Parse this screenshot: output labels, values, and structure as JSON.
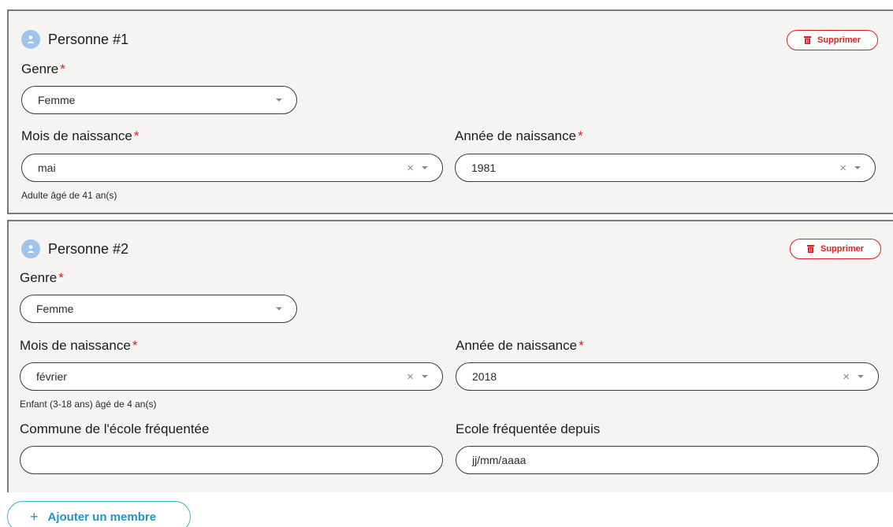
{
  "persons": [
    {
      "title": "Personne #1",
      "delete_label": "Supprimer",
      "genre_label": "Genre",
      "genre_value": "Femme",
      "month_label": "Mois de naissance",
      "month_value": "mai",
      "year_label": "Année de naissance",
      "year_value": "1981",
      "age_hint": "Adulte âgé de 41 an(s)"
    },
    {
      "title": "Personne #2",
      "delete_label": "Supprimer",
      "genre_label": "Genre",
      "genre_value": "Femme",
      "month_label": "Mois de naissance",
      "month_value": "février",
      "year_label": "Année de naissance",
      "year_value": "2018",
      "age_hint": "Enfant (3-18 ans) âgé de 4 an(s)",
      "school_commune_label": "Commune de l'école fréquentée",
      "school_commune_value": "",
      "school_since_label": "Ecole fréquentée depuis",
      "school_since_placeholder": "jj/mm/aaaa"
    }
  ],
  "required_marker": "*",
  "clear_symbol": "×",
  "add_member": {
    "icon": "+",
    "label": "Ajouter un membre"
  },
  "colors": {
    "required": "#e02020",
    "delete": "#e02020",
    "accent": "#1f95c4",
    "avatar": "#9ec3ec",
    "card_bg": "#f5f4f3"
  },
  "icons": {
    "avatar": "person-icon",
    "delete": "trash-icon",
    "dropdown": "caret-down-icon",
    "clear": "clear-icon",
    "add": "plus-icon"
  }
}
